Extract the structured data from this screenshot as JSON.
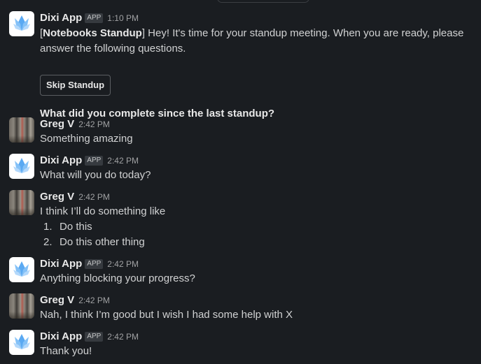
{
  "messages": [
    {
      "sender": "Dixi App",
      "badge": "APP",
      "time": "1:10 PM",
      "intro_prefix": "[",
      "intro_bold": "Notebooks Standup",
      "intro_text": "] Hey! It's time for your standup meeting. When you are ready, please answer the following questions.",
      "button_label": "Skip Standup",
      "question": "What did you complete since the last standup?"
    },
    {
      "sender": "Greg V",
      "time": "2:42 PM",
      "text": "Something amazing"
    },
    {
      "sender": "Dixi App",
      "badge": "APP",
      "time": "2:42 PM",
      "text": "What will you do today?"
    },
    {
      "sender": "Greg V",
      "time": "2:42 PM",
      "text": "I think I’ll do something like",
      "list": [
        {
          "num": "1.",
          "text": "Do this"
        },
        {
          "num": "2.",
          "text": "Do this other thing"
        }
      ]
    },
    {
      "sender": "Dixi App",
      "badge": "APP",
      "time": "2:42 PM",
      "text": "Anything blocking your progress?"
    },
    {
      "sender": "Greg V",
      "time": "2:42 PM",
      "text": "Nah, I think I’m good but I wish I had some help with X"
    },
    {
      "sender": "Dixi App",
      "badge": "APP",
      "time": "2:42 PM",
      "text": "Thank you!"
    }
  ],
  "colors": {
    "background": "#1a1d21",
    "text": "#d1d2d3",
    "bot_logo": "#5aa9f2"
  },
  "icons": {
    "bot_avatar": "dixi-lotus-logo",
    "user_avatar": "photo-avatar"
  }
}
